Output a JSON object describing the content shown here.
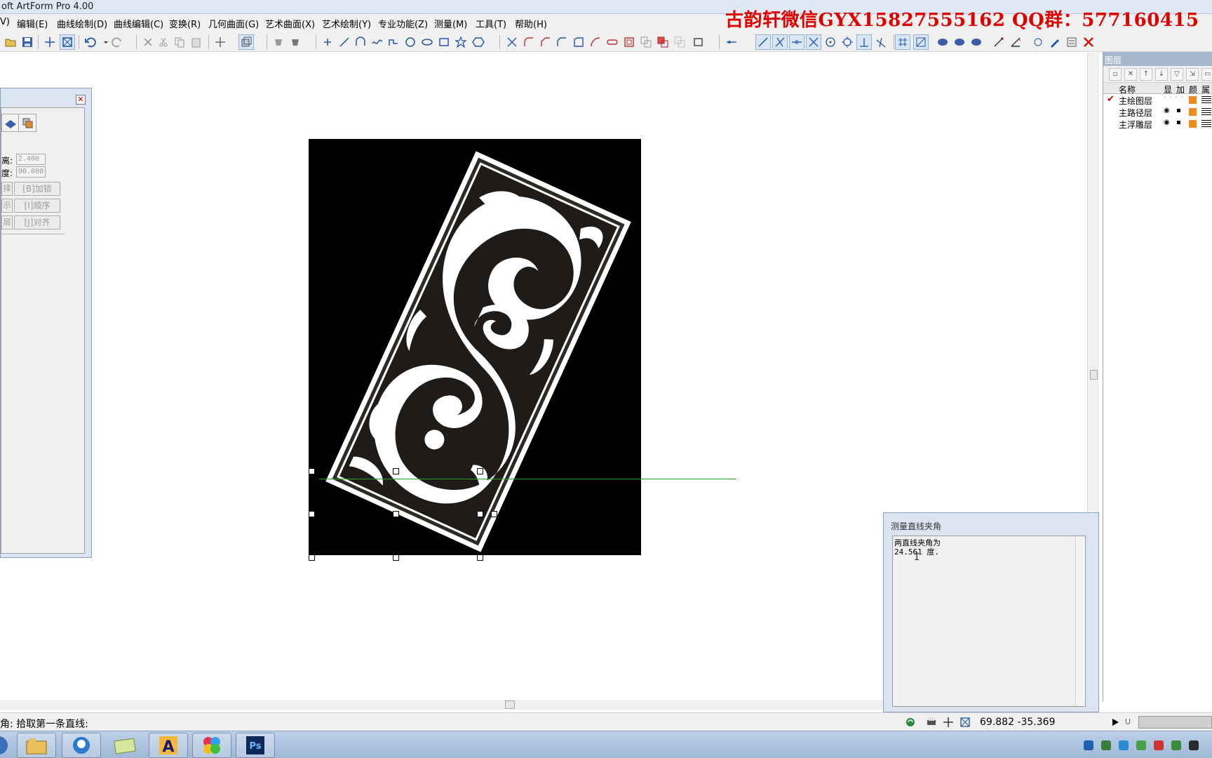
{
  "window": {
    "title": "oft ArtForm Pro 4.00"
  },
  "menu": {
    "items": [
      {
        "label": "V)"
      },
      {
        "label": "编辑(E)"
      },
      {
        "label": "曲线绘制(D)"
      },
      {
        "label": "曲线编辑(C)"
      },
      {
        "label": "变换(R)"
      },
      {
        "label": "几何曲面(G)"
      },
      {
        "label": "艺术曲面(X)"
      },
      {
        "label": "艺术绘制(Y)"
      },
      {
        "label": "专业功能(Z)"
      },
      {
        "label": "测量(M)"
      },
      {
        "label": "工具(T)"
      },
      {
        "label": "帮助(H)"
      }
    ]
  },
  "watermark": {
    "text": "古韵轩微信GYX15827555162 QQ群：577160415"
  },
  "left_panel": {
    "close_glyph": "✕",
    "distance_label": "离:",
    "distance_value": "2.400",
    "angle_label": "度:",
    "angle_value": "90.000",
    "buttons": [
      {
        "stub": "择",
        "label": "[B]加锁"
      },
      {
        "stub": "示",
        "label": "[I]顺序"
      },
      {
        "stub": "层",
        "label": "[J]对齐"
      }
    ]
  },
  "layers_panel": {
    "title": "图层",
    "columns": {
      "name": "名称",
      "show": "显",
      "add": "加",
      "color": "颜",
      "attr": "属"
    },
    "rows": [
      {
        "name": "主绘图层",
        "checked": true,
        "color": "#f08a1c"
      },
      {
        "name": "主路径层",
        "checked": false,
        "color": "#f08a1c"
      },
      {
        "name": "主浮雕层",
        "checked": false,
        "color": "#f08a1c"
      }
    ]
  },
  "measure_dialog": {
    "title": "测量直线夹角",
    "line1": "两直线夹角为",
    "line2": "24.561 度."
  },
  "statusbar": {
    "prompt": "角: 拾取第一条直线:",
    "coords": "69.882  -35.369",
    "u_label": "U"
  },
  "colors": {
    "watermark": "#e00000",
    "measure_line": "#23a323",
    "artwork_bg": "#000000",
    "artwork_fg": "#ffffff",
    "layer_color": "#f08a1c"
  },
  "taskbar": {
    "apps": [
      {
        "icon": "file-explorer-icon"
      },
      {
        "icon": "qq-icon"
      },
      {
        "icon": "folder-icon"
      },
      {
        "icon": "artform-icon",
        "label": "A"
      },
      {
        "icon": "pinwheel-icon"
      },
      {
        "icon": "photoshop-icon",
        "label": "Ps"
      }
    ]
  }
}
